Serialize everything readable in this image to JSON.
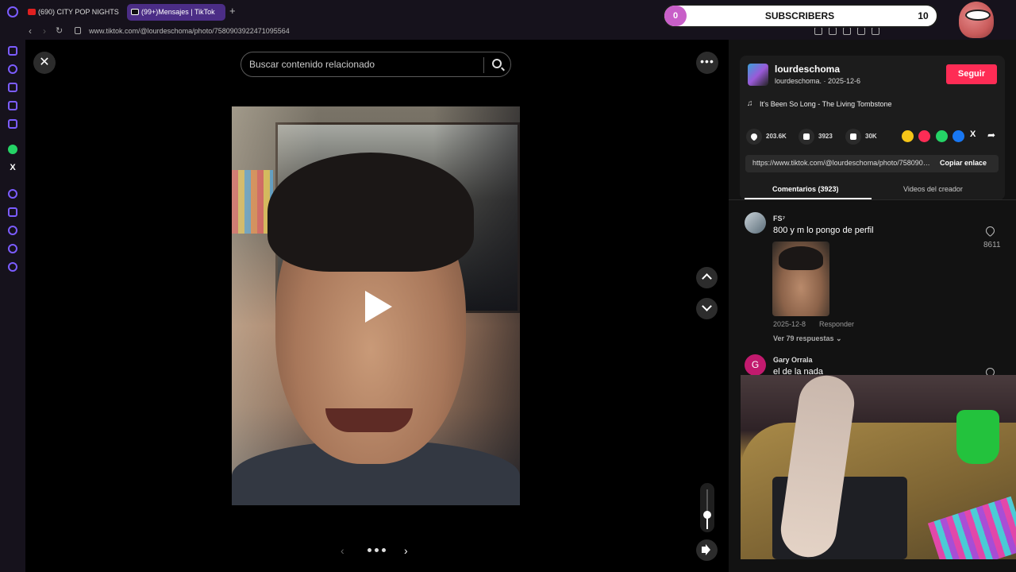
{
  "browser": {
    "tabs": [
      {
        "label": "(690) CITY POP NIGHTS"
      },
      {
        "label": "(99+)Mensajes | TikTok"
      }
    ],
    "new_tab": "+",
    "url": "www.tiktok.com/@lourdeschoma/photo/7580903922471095564"
  },
  "viewer": {
    "close_glyph": "✕",
    "more_glyph": "•••",
    "search_placeholder": "Buscar contenido relacionado",
    "pager_prev": "‹",
    "pager_next": "›",
    "volume_level": 0.35
  },
  "author": {
    "name": "lourdeschoma",
    "sub": "lourdeschoma. · 2025-12-6",
    "follow_label": "Seguir",
    "music_glyph": "♫",
    "music": "It's Been So Long - The Living Tombstone"
  },
  "stats": {
    "likes": "203.6K",
    "comments": "3923",
    "saves": "30K"
  },
  "share": {
    "link": "https://www.tiktok.com/@lourdeschoma/photo/7580903922471095564",
    "copy_label": "Copiar enlace",
    "x_glyph": "X",
    "colors": {
      "coin": "#f5c518",
      "tiktok": "#fe2c55",
      "whatsapp": "#25d366",
      "facebook": "#1877f2"
    }
  },
  "tabs": {
    "comments": "Comentarios (3923)",
    "videos": "Videos del creador"
  },
  "comments": [
    {
      "user": "FS⁷",
      "text": "800 y m lo pongo de perfil",
      "likes": "8611",
      "date": "2025-12-8",
      "reply": "Responder",
      "more": "Ver 79 respuestas ⌄"
    },
    {
      "initial": "G",
      "user": "Gary Orrala",
      "text": "el de la nada"
    }
  ],
  "overlay": {
    "sub_count": "0",
    "sub_label": "SUBSCRIBERS",
    "sub_goal": "10"
  },
  "sidebar": {
    "x_glyph": "X"
  },
  "accent": "#fe2c55"
}
